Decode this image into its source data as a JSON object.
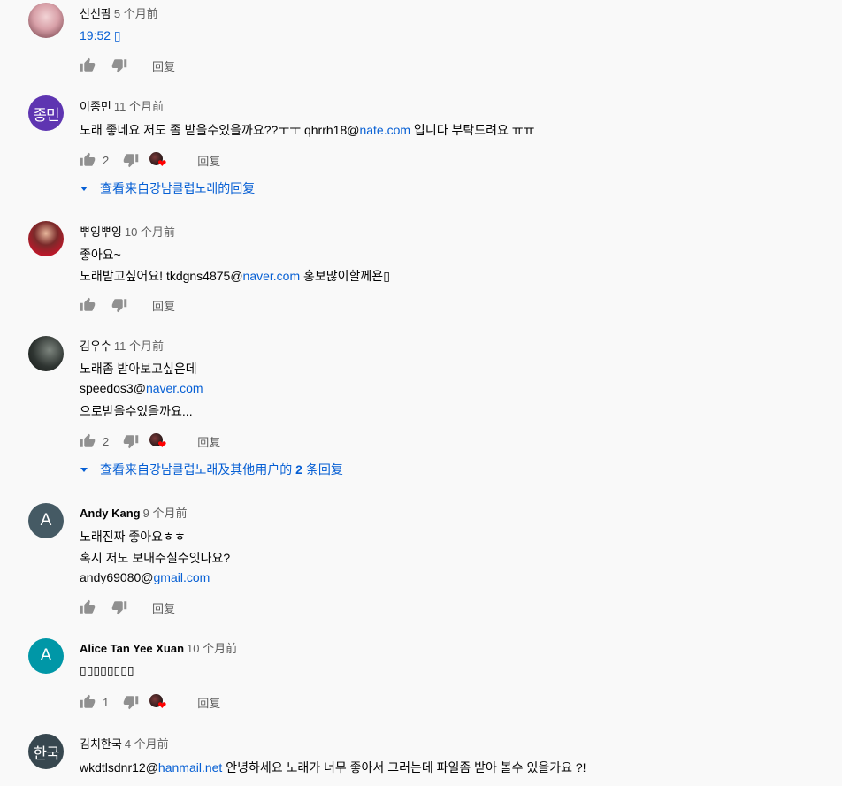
{
  "reply_label": "回复",
  "comments": [
    {
      "author": "신선팜",
      "time": "5 个月前",
      "lines": [
        {
          "text": "19:52 ▯"
        }
      ],
      "likes": "",
      "hearted": false,
      "avatar": {
        "kind": "photo",
        "color": "#d8a0a8"
      }
    },
    {
      "author": "이종민",
      "time": "11 个月前",
      "lines": [
        {
          "pre": "노래 좋네요 저도 좀 받을수있을까요??ㅜㅜ qhrrh18@",
          "link": "nate.com",
          "post": " 입니다 부탁드려요 ㅠㅠ"
        }
      ],
      "likes": "2",
      "hearted": true,
      "avatar": {
        "kind": "text",
        "text": "종민",
        "color": "#5e35b1"
      },
      "show_replies": {
        "text": "查看来自강남클럽노래的回复"
      }
    },
    {
      "author": "뿌잉뿌잉",
      "time": "10 个月前",
      "lines": [
        {
          "text": "좋아요~"
        },
        {
          "pre": "노래받고싶어요! tkdgns4875@",
          "link": "naver.com",
          "post": " 홍보많이할께욘▯"
        }
      ],
      "likes": "",
      "hearted": false,
      "avatar": {
        "kind": "photo",
        "color": "#b3202c"
      }
    },
    {
      "author": "김우수",
      "time": "11 个月前",
      "lines": [
        {
          "text": "노래좀 받아보고싶은데"
        },
        {
          "pre": "speedos3@",
          "link": "naver.com",
          "post": ""
        },
        {
          "text": "으로받을수있을까요..."
        }
      ],
      "likes": "2",
      "hearted": true,
      "avatar": {
        "kind": "photo",
        "color": "#3a3f3c"
      },
      "show_replies": {
        "pre": "查看来自강남클럽노래及其他用户的 ",
        "bold": "2",
        "post": " 条回复"
      }
    },
    {
      "author": "Andy Kang",
      "time": "9 个月前",
      "lines": [
        {
          "text": "노래진짜 좋아요ㅎㅎ"
        },
        {
          "text": "혹시 저도 보내주실수잇나요?"
        },
        {
          "pre": "andy69080@",
          "link": "gmail.com",
          "post": ""
        }
      ],
      "likes": "",
      "hearted": false,
      "avatar": {
        "kind": "text",
        "text": "A",
        "color": "#455a64"
      }
    },
    {
      "author": "Alice Tan Yee Xuan",
      "time": "10 个月前",
      "lines": [
        {
          "text": "▯▯▯▯▯▯▯▯"
        }
      ],
      "likes": "1",
      "hearted": true,
      "avatar": {
        "kind": "text",
        "text": "A",
        "color": "#0097a7"
      }
    },
    {
      "author": "김치한국",
      "time": "4 个月前",
      "lines": [
        {
          "pre": "wkdtlsdnr12@",
          "link": "hanmail.net",
          "post": " 안녕하세요 노래가 너무 좋아서 그러는데 파일좀 받아 볼수 있을가요 ?!"
        }
      ],
      "likes": "",
      "hearted": false,
      "avatar": {
        "kind": "text",
        "text": "한국",
        "color": "#37474f"
      }
    }
  ]
}
